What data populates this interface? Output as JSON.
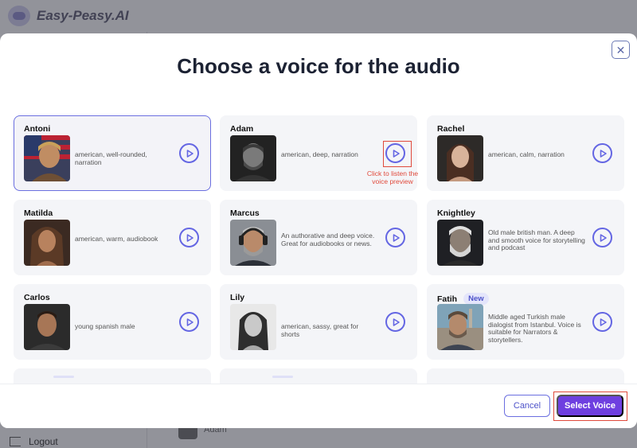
{
  "app": {
    "name": "Easy-Peasy.AI",
    "logout_label": "Logout",
    "bottom_item_label": "Adam"
  },
  "modal": {
    "title": "Choose a voice for the audio",
    "close_icon": "close-icon",
    "hint": "Click to listen the voice preview",
    "cancel_label": "Cancel",
    "select_label": "Select Voice"
  },
  "voices": [
    {
      "name": "Antoni",
      "desc": "american, well-rounded, narration",
      "selected": true
    },
    {
      "name": "Adam",
      "desc": "american, deep, narration"
    },
    {
      "name": "Rachel",
      "desc": "american, calm, narration"
    },
    {
      "name": "Matilda",
      "desc": "american, warm, audiobook"
    },
    {
      "name": "Marcus",
      "desc": "An authorative and deep voice. Great for audiobooks or news."
    },
    {
      "name": "Knightley",
      "desc": "Old male british man. A deep and smooth voice for storytelling and podcast"
    },
    {
      "name": "Carlos",
      "desc": "young spanish male"
    },
    {
      "name": "Lily",
      "desc": "american, sassy, great for shorts"
    },
    {
      "name": "Fatih",
      "badge": "New",
      "desc": "Middle aged Turkish male dialogist from Istanbul. Voice is suitable for Narrators & storytellers."
    }
  ],
  "colors": {
    "accent": "#6466e3",
    "primary_button": "#6e3fe0",
    "annotation": "#e04a3c"
  }
}
